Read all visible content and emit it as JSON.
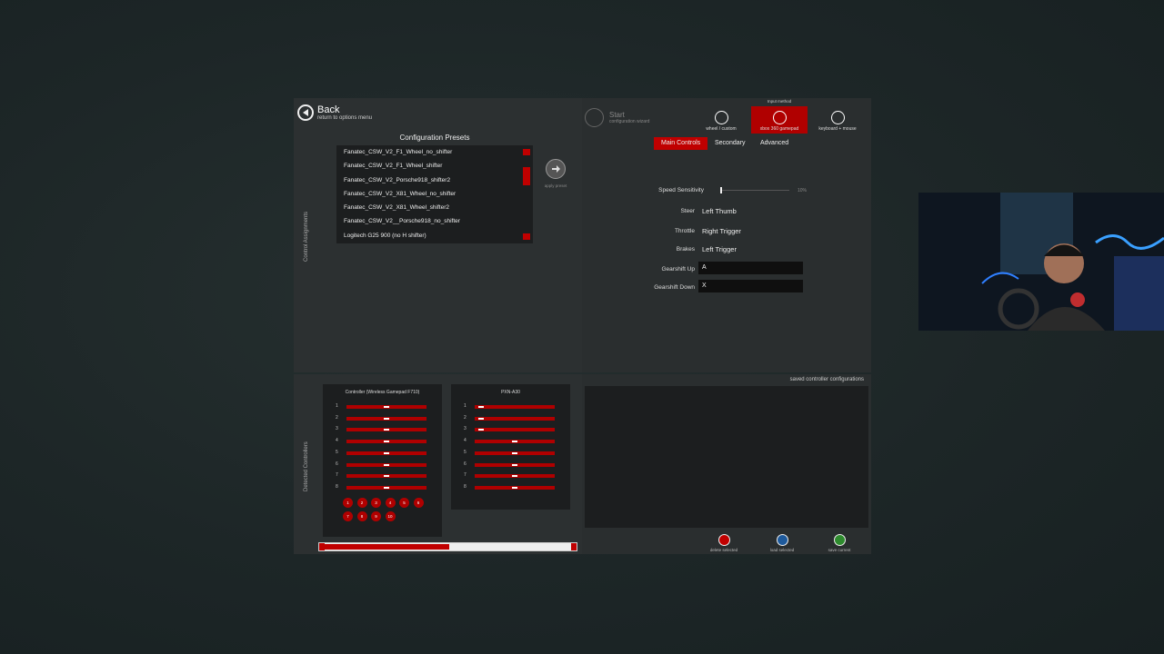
{
  "header": {
    "back_label": "Back",
    "back_sub": "return to options menu",
    "presets_title": "Configuration Presets",
    "apply_label": "apply preset",
    "start_label": "Start",
    "start_sub": "configuration wizard",
    "input_method_label": "Input method"
  },
  "presets": [
    "Fanatec_CSW_V2_F1_Wheel_no_shifter",
    "Fanatec_CSW_V2_F1_Wheel_shifter",
    "Fanatec_CSW_V2_Porsche918_shifter2",
    "Fanatec_CSW_V2_X81_Wheel_no_shifter",
    "Fanatec_CSW_V2_X81_Wheel_shifter2",
    "Fanatec_CSW_V2__Porsche918_no_shifter",
    "Logitech G25 900 (no H shifter)"
  ],
  "input_methods": [
    {
      "label": "wheel / custom",
      "active": false
    },
    {
      "label": "xbox 360 gamepad",
      "active": true
    },
    {
      "label": "keyboard + mouse",
      "active": false
    }
  ],
  "tabs": [
    {
      "label": "Main Controls",
      "active": true
    },
    {
      "label": "Secondary",
      "active": false
    },
    {
      "label": "Advanced",
      "active": false
    }
  ],
  "mapping": {
    "speed_sensitivity_label": "Speed Sensitivity",
    "speed_sensitivity_value": "10%",
    "speed_sensitivity_level": 0.1,
    "steer_label": "Steer",
    "steer_value": "Left Thumb",
    "throttle_label": "Throttle",
    "throttle_value": "Right Trigger",
    "brakes_label": "Brakes",
    "brakes_value": "Left Trigger",
    "gearup_label": "Gearshift Up",
    "gearup_value": "A",
    "geardown_label": "Gearshift Down",
    "geardown_value": "X"
  },
  "side_labels": {
    "control_assignments": "Control Assignments",
    "detected_controllers": "Detected Controllers"
  },
  "controllers": [
    {
      "name": "Controller (Wireless Gamepad F710)",
      "axes": [
        "1",
        "2",
        "3",
        "4",
        "5",
        "6",
        "7",
        "8"
      ],
      "axis_levels": [
        0.5,
        0.5,
        0.5,
        0.5,
        0.5,
        0.5,
        0.5,
        0.5
      ],
      "buttons": [
        "1",
        "2",
        "3",
        "4",
        "5",
        "6",
        "7",
        "8",
        "9",
        "10"
      ]
    },
    {
      "name": "PXN-A30",
      "axes": [
        "1",
        "2",
        "3",
        "4",
        "5",
        "6",
        "7",
        "8"
      ],
      "axis_levels": [
        0.05,
        0.05,
        0.05,
        0.5,
        0.5,
        0.5,
        0.5,
        0.5
      ],
      "buttons": []
    }
  ],
  "saved": {
    "title": "saved controller configurations",
    "delete_label": "delete selected",
    "load_label": "load selected",
    "save_label": "save current"
  },
  "colors": {
    "accent": "#c00000",
    "panel": "#2b2f30",
    "background": "#1d2627"
  }
}
